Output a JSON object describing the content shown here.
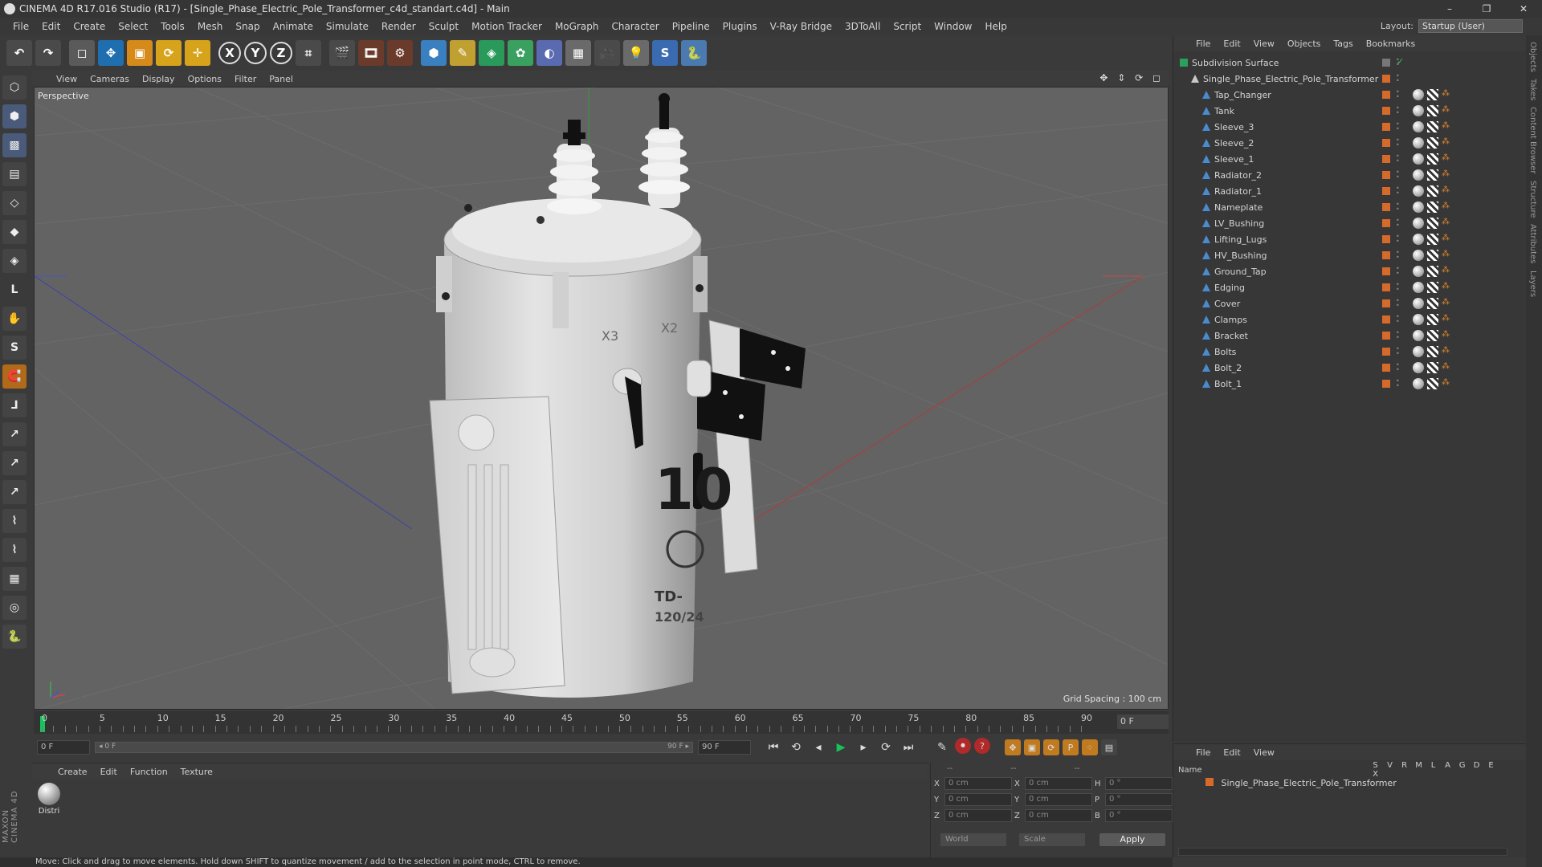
{
  "app": {
    "title": "CINEMA 4D R17.016 Studio (R17) - [Single_Phase_Electric_Pole_Transformer_c4d_standart.c4d] - Main",
    "window_controls": [
      "–",
      "❐",
      "✕"
    ]
  },
  "menubar": {
    "items": [
      "File",
      "Edit",
      "Create",
      "Select",
      "Tools",
      "Mesh",
      "Snap",
      "Animate",
      "Simulate",
      "Render",
      "Sculpt",
      "Motion Tracker",
      "MoGraph",
      "Character",
      "Pipeline",
      "Plugins",
      "V-Ray Bridge",
      "3DToAll",
      "Script",
      "Window",
      "Help"
    ],
    "layout_label": "Layout:",
    "layout_value": "Startup (User)"
  },
  "toolbar": {
    "buttons": [
      {
        "name": "undo-icon",
        "glyph": "↶"
      },
      {
        "name": "redo-icon",
        "glyph": "↷"
      },
      {
        "name": "live-select-icon",
        "glyph": "◻"
      },
      {
        "name": "move-icon",
        "glyph": "✥"
      },
      {
        "name": "scale-icon",
        "glyph": "▣"
      },
      {
        "name": "rotate-icon",
        "glyph": "⟳"
      },
      {
        "name": "transform-icon",
        "glyph": "✛"
      },
      {
        "name": "x-axis-icon",
        "glyph": "X"
      },
      {
        "name": "y-axis-icon",
        "glyph": "Y"
      },
      {
        "name": "z-axis-icon",
        "glyph": "Z"
      },
      {
        "name": "coordinate-system-icon",
        "glyph": "⌗"
      },
      {
        "name": "render-view-icon",
        "glyph": "🎬"
      },
      {
        "name": "render-picture-viewer-icon",
        "glyph": "🎞"
      },
      {
        "name": "render-settings-icon",
        "glyph": "⚙"
      },
      {
        "name": "cube-icon",
        "glyph": "⬢"
      },
      {
        "name": "pen-spline-icon",
        "glyph": "✎"
      },
      {
        "name": "subdivision-icon",
        "glyph": "◈"
      },
      {
        "name": "array-icon",
        "glyph": "✿"
      },
      {
        "name": "deformer-icon",
        "glyph": "◐"
      },
      {
        "name": "floor-icon",
        "glyph": "▦"
      },
      {
        "name": "camera-icon",
        "glyph": "🎥"
      },
      {
        "name": "light-icon",
        "glyph": "💡"
      },
      {
        "name": "python-generator-icon",
        "glyph": "S"
      },
      {
        "name": "python-icon",
        "glyph": "🐍"
      }
    ]
  },
  "leftbar": {
    "buttons": [
      {
        "name": "make-editable-icon",
        "glyph": "⬡"
      },
      {
        "name": "model-mode-icon",
        "glyph": "⬢"
      },
      {
        "name": "texture-mode-icon",
        "glyph": "▩"
      },
      {
        "name": "workplane-icon",
        "glyph": "▤"
      },
      {
        "name": "points-mode-icon",
        "glyph": "◇"
      },
      {
        "name": "edges-mode-icon",
        "glyph": "◆"
      },
      {
        "name": "polygons-mode-icon",
        "glyph": "◈"
      },
      {
        "name": "axis-mode-icon",
        "glyph": "L"
      },
      {
        "name": "tweak-icon",
        "glyph": "✋"
      },
      {
        "name": "solo-icon",
        "glyph": "S"
      },
      {
        "name": "snap-icon",
        "glyph": "🧲"
      },
      {
        "name": "axis-lock-icon",
        "glyph": "⅃"
      },
      {
        "name": "lock-x-icon",
        "glyph": "↗"
      },
      {
        "name": "lock-y-icon",
        "glyph": "↗"
      },
      {
        "name": "lock-z-icon",
        "glyph": "↗"
      },
      {
        "name": "brush-icon",
        "glyph": "⌇"
      },
      {
        "name": "paint-icon",
        "glyph": "⌇"
      },
      {
        "name": "grid-lock-icon",
        "glyph": "▦"
      },
      {
        "name": "sculpt-icon",
        "glyph": "◎"
      },
      {
        "name": "python-console-icon",
        "glyph": "🐍"
      }
    ],
    "brand": "MAXON CINEMA 4D"
  },
  "viewport": {
    "menu": [
      "View",
      "Cameras",
      "Display",
      "Options",
      "Filter",
      "Panel"
    ],
    "nav_icons": "✥ ⇕ ⟳ ◻",
    "label": "Perspective",
    "grid_spacing": "Grid Spacing : 100 cm",
    "decal_big": "10",
    "decal_small1": "TD-",
    "decal_small2": "120/24",
    "decal_x": "X3",
    "decal_x2": "X2"
  },
  "timeline": {
    "ticks": [
      "0",
      "5",
      "10",
      "15",
      "20",
      "25",
      "30",
      "35",
      "40",
      "45",
      "50",
      "55",
      "60",
      "65",
      "70",
      "75",
      "80",
      "85",
      "90"
    ],
    "current_frame": "0 F"
  },
  "controls": {
    "start_field": "0 F",
    "range_start": "◂ 0 F",
    "range_end": "90 F ▸",
    "end_field": "90 F",
    "playback": [
      {
        "name": "go-to-start-icon",
        "glyph": "⏮"
      },
      {
        "name": "prev-key-icon",
        "glyph": "⟲"
      },
      {
        "name": "prev-frame-icon",
        "glyph": "◂"
      },
      {
        "name": "play-icon",
        "glyph": "▶"
      },
      {
        "name": "next-frame-icon",
        "glyph": "▸"
      },
      {
        "name": "next-key-icon",
        "glyph": "⟳"
      },
      {
        "name": "go-to-end-icon",
        "glyph": "⏭"
      }
    ],
    "record": [
      {
        "name": "motion-record-icon",
        "glyph": "✎"
      },
      {
        "name": "record-key-icon",
        "glyph": "⏺"
      },
      {
        "name": "autokey-icon",
        "glyph": "?"
      }
    ],
    "keys": [
      {
        "name": "key-position-icon",
        "glyph": "✥"
      },
      {
        "name": "key-scale-icon",
        "glyph": "▣"
      },
      {
        "name": "key-rotation-icon",
        "glyph": "⟳"
      },
      {
        "name": "key-param-icon",
        "glyph": "P"
      },
      {
        "name": "key-pla-icon",
        "glyph": "⁘"
      },
      {
        "name": "timeline-icon",
        "glyph": "▤"
      }
    ]
  },
  "material_panel": {
    "menu": [
      "Create",
      "Edit",
      "Function",
      "Texture"
    ],
    "materials": [
      {
        "name": "Distri"
      }
    ]
  },
  "coord_panel": {
    "headers": [
      "--",
      "--",
      "--"
    ],
    "rows": [
      {
        "axis": "X",
        "pos": "0 cm",
        "axis2": "X",
        "size": "0 cm",
        "rot_label": "H",
        "rot": "0 °"
      },
      {
        "axis": "Y",
        "pos": "0 cm",
        "axis2": "Y",
        "size": "0 cm",
        "rot_label": "P",
        "rot": "0 °"
      },
      {
        "axis": "Z",
        "pos": "0 cm",
        "axis2": "Z",
        "size": "0 cm",
        "rot_label": "B",
        "rot": "0 °"
      }
    ],
    "world": "World",
    "scale": "Scale",
    "apply": "Apply"
  },
  "status": {
    "text": "Move: Click and drag to move elements. Hold down SHIFT to quantize movement / add to the selection in point mode, CTRL to remove."
  },
  "object_manager": {
    "menu": [
      "File",
      "Edit",
      "View",
      "Objects",
      "Tags",
      "Bookmarks"
    ],
    "objects": [
      {
        "label": "Subdivision Surface",
        "indent": 0
      },
      {
        "label": "Single_Phase_Electric_Pole_Transformer",
        "indent": 1
      },
      {
        "label": "Tap_Changer",
        "indent": 2
      },
      {
        "label": "Tank",
        "indent": 2
      },
      {
        "label": "Sleeve_3",
        "indent": 2
      },
      {
        "label": "Sleeve_2",
        "indent": 2
      },
      {
        "label": "Sleeve_1",
        "indent": 2
      },
      {
        "label": "Radiator_2",
        "indent": 2
      },
      {
        "label": "Radiator_1",
        "indent": 2
      },
      {
        "label": "Nameplate",
        "indent": 2
      },
      {
        "label": "LV_Bushing",
        "indent": 2
      },
      {
        "label": "Lifting_Lugs",
        "indent": 2
      },
      {
        "label": "HV_Bushing",
        "indent": 2
      },
      {
        "label": "Ground_Tap",
        "indent": 2
      },
      {
        "label": "Edging",
        "indent": 2
      },
      {
        "label": "Cover",
        "indent": 2
      },
      {
        "label": "Clamps",
        "indent": 2
      },
      {
        "label": "Bracket",
        "indent": 2
      },
      {
        "label": "Bolts",
        "indent": 2
      },
      {
        "label": "Bolt_2",
        "indent": 2
      },
      {
        "label": "Bolt_1",
        "indent": 2
      }
    ]
  },
  "layer_manager": {
    "menu": [
      "File",
      "Edit",
      "View"
    ],
    "name_header": "Name",
    "cols": [
      "S",
      "V",
      "R",
      "M",
      "L",
      "A",
      "G",
      "D",
      "E",
      "X"
    ],
    "layers": [
      {
        "label": "Single_Phase_Electric_Pole_Transformer"
      }
    ]
  },
  "side_tabs": [
    "Objects",
    "Takes",
    "Content Browser",
    "Structure",
    "Attributes",
    "Layers"
  ],
  "colors": {
    "accent_orange": "#d66a2a",
    "playhead_green": "#18c25b",
    "viewport_bg": "#636363"
  }
}
